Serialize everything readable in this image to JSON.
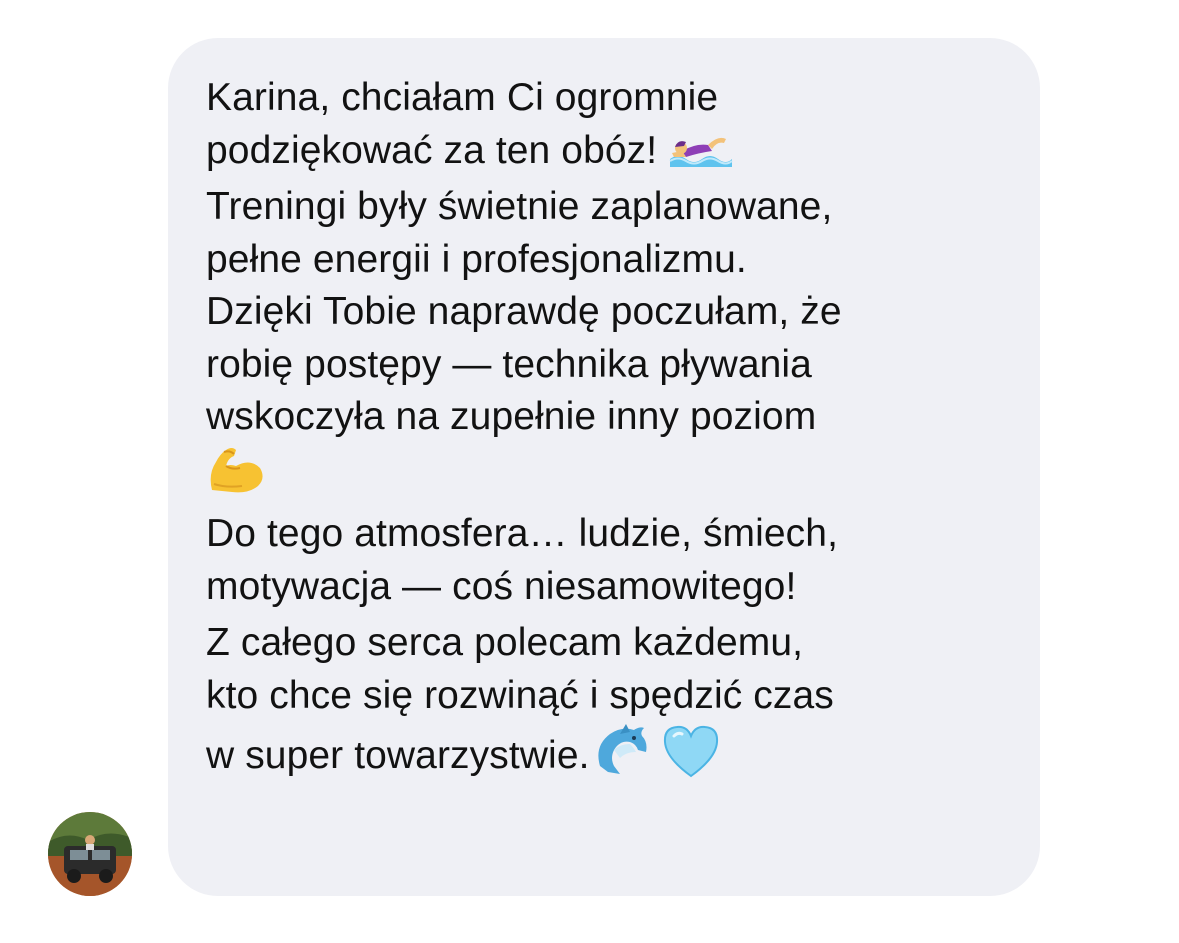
{
  "message": {
    "paragraphs": [
      {
        "lines": [
          "Karina, chciałam Ci ogromnie",
          "podziękować za ten obóz! "
        ]
      },
      {
        "lines": [
          "Treningi były świetnie zaplanowane,",
          "pełne energii i profesjonalizmu.",
          "Dzięki Tobie naprawdę poczułam, że",
          "robię postępy — technika pływania",
          "wskoczyła na zupełnie inny poziom"
        ]
      },
      {
        "lines": [
          "Do tego atmosfera… ludzie, śmiech,",
          "motywacja — coś niesamowitego!"
        ]
      },
      {
        "lines": [
          "Z całego serca polecam każdemu,",
          "kto chce się rozwinąć i spędzić czas",
          "w super towarzystwie."
        ]
      }
    ],
    "emojis": {
      "swimmer": "swimmer-emoji",
      "bicep": "flexed-biceps-emoji",
      "dolphin": "dolphin-emoji",
      "heart": "light-blue-heart-emoji"
    }
  },
  "colors": {
    "bubble_background": "#eff0f5",
    "text": "#121212",
    "page_background": "#ffffff"
  }
}
